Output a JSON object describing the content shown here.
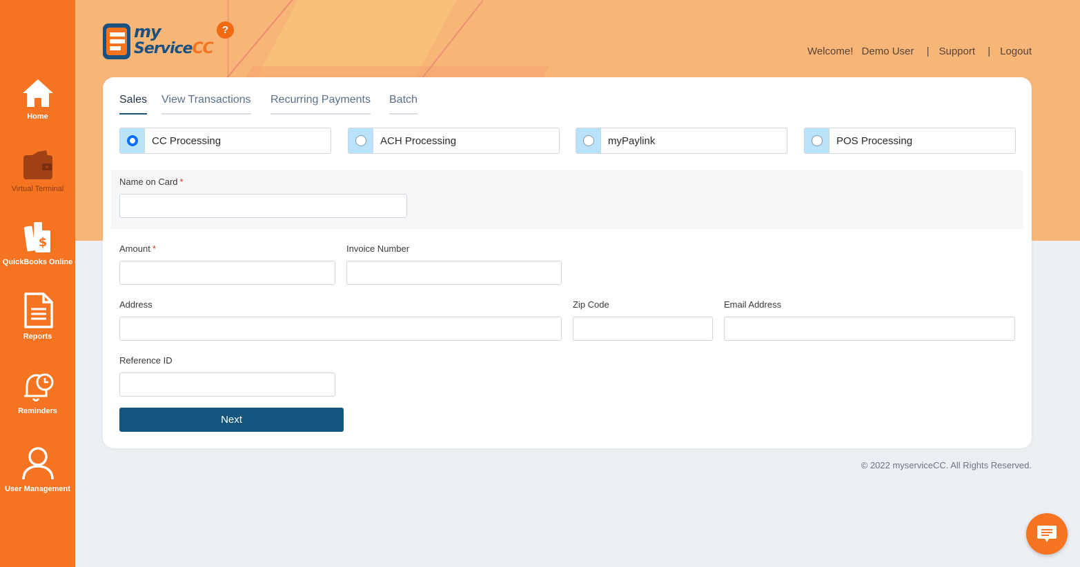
{
  "sidebar": {
    "items": [
      {
        "label": "Home",
        "icon": "home-icon"
      },
      {
        "label": "Virtual Terminal",
        "icon": "wallet-icon"
      },
      {
        "label": "QuickBooks Online",
        "icon": "books-dollar-icon"
      },
      {
        "label": "Reports",
        "icon": "document-icon"
      },
      {
        "label": "Reminders",
        "icon": "bell-clock-icon"
      },
      {
        "label": "User Management",
        "icon": "user-icon"
      }
    ]
  },
  "header": {
    "logo_line1": "my",
    "logo_line2_a": "Service",
    "logo_line2_b": "CC",
    "help": "?",
    "welcome": "Welcome!",
    "user": "Demo User",
    "separator": "|",
    "support": "Support",
    "logout": "Logout"
  },
  "tabs": [
    "Sales",
    "View Transactions",
    "Recurring Payments",
    "Batch"
  ],
  "processing": [
    {
      "label": "CC Processing",
      "selected": true
    },
    {
      "label": "ACH Processing",
      "selected": false
    },
    {
      "label": "myPaylink",
      "selected": false
    },
    {
      "label": "POS Processing",
      "selected": false
    }
  ],
  "form": {
    "name_on_card": "Name on Card",
    "required_mark": "*",
    "amount": "Amount",
    "invoice_number": "Invoice Number",
    "address": "Address",
    "zip_code": "Zip Code",
    "email_address": "Email Address",
    "reference_id": "Reference ID",
    "next": "Next"
  },
  "footer": "© 2022 myserviceCC. All Rights Reserved.",
  "colors": {
    "sidebar": "#f47421",
    "banner": "#f7b678",
    "primary_button": "#12567e",
    "radio_bg": "#b8e3fb"
  }
}
